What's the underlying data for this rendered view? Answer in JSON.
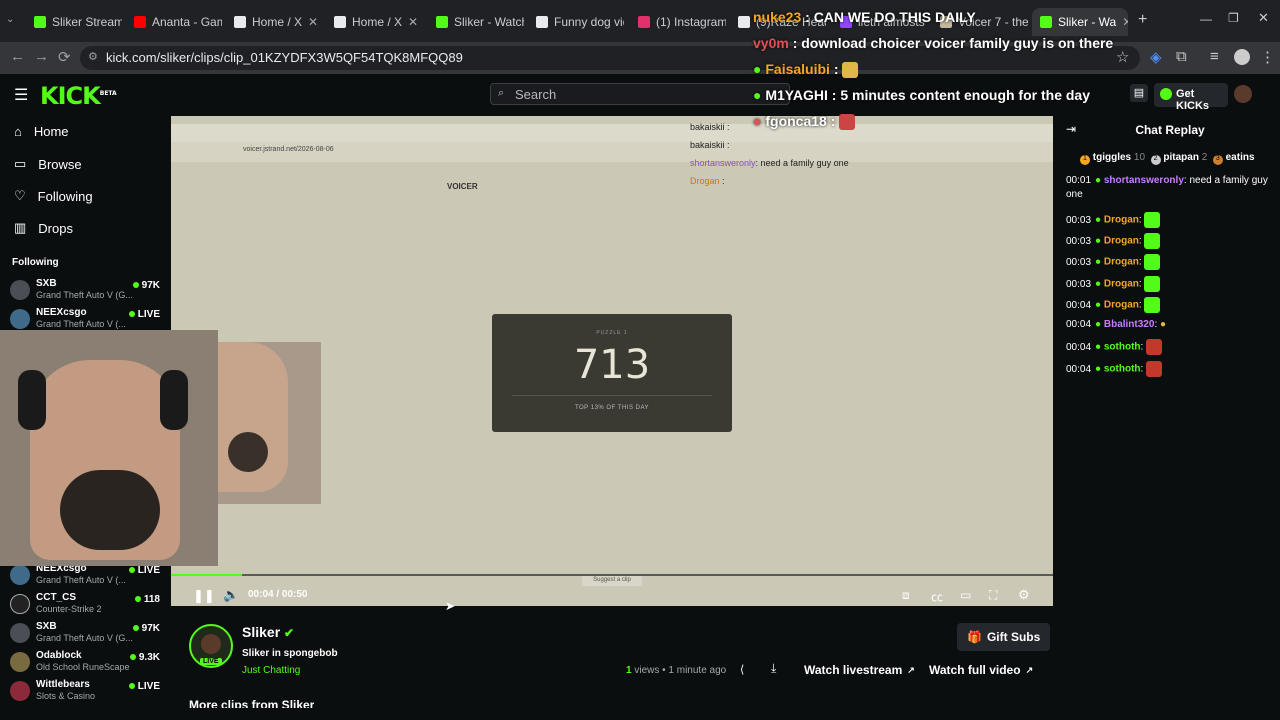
{
  "browser": {
    "tabs": [
      {
        "title": "Sliker Stream",
        "color": "#53fc18"
      },
      {
        "title": "Ananta - Game",
        "color": "#ff0000"
      },
      {
        "title": "Home / X",
        "color": "#e8eaed"
      },
      {
        "title": "Home / X",
        "color": "#e8eaed"
      },
      {
        "title": "Sliker - Watch",
        "color": "#53fc18"
      },
      {
        "title": "Funny dog vid",
        "color": "#e8eaed"
      },
      {
        "title": "(1) Instagram",
        "color": "#e1306c"
      },
      {
        "title": "(9)Raze Head",
        "color": "#e8eaed"
      },
      {
        "title": "lieth almosts g",
        "color": "#9146ff"
      },
      {
        "title": "Voicer 7 - the",
        "color": "#c5b79a"
      },
      {
        "title": "Sliker - Wa",
        "color": "#53fc18"
      }
    ],
    "url": "kick.com/sliker/clips/clip_01KZYDFX3W5QF54TQK8MFQQ89"
  },
  "topnav": {
    "logo": "KICK",
    "logo_beta": "BETA",
    "search_placeholder": "Search",
    "get_kicks": "Get KICKs"
  },
  "sidebar": {
    "menu": [
      "Home",
      "Browse",
      "Following",
      "Drops"
    ],
    "following_title": "Following",
    "following": [
      {
        "name": "SXB",
        "game": "Grand Theft Auto V (G...",
        "count": "97K"
      },
      {
        "name": "NEEXcsgo",
        "game": "Grand Theft Auto V (...",
        "count": "LIVE"
      }
    ],
    "following_lower": [
      {
        "name": "NEEXcsgo",
        "game": "Grand Theft Auto V (...",
        "count": "LIVE"
      },
      {
        "name": "CCT_CS",
        "game": "Counter-Strike 2",
        "count": "118"
      },
      {
        "name": "SXB",
        "game": "Grand Theft Auto V (G...",
        "count": "97K"
      },
      {
        "name": "Odablock",
        "game": "Old School RuneScape",
        "count": "9.3K"
      },
      {
        "name": "Wittlebears",
        "game": "Slots & Casino",
        "count": "LIVE"
      }
    ]
  },
  "stream_overlay": {
    "chat": [
      {
        "user": "nuke23",
        "text": ": CAN WE DO THIS DAILY",
        "color": "#f5a623"
      },
      {
        "user": "vy0m",
        "text": ": download choicer voicer family guy is on there",
        "color": "#e05050"
      },
      {
        "user": "Faisaluibi",
        "text": ":",
        "color": "#f5a623"
      },
      {
        "user": "M1YAGHI",
        "text": ": 5 minutes content enough for the day",
        "color": "#ffffff"
      },
      {
        "user": "fgonca18",
        "text": ":",
        "color": "#ffffff"
      }
    ],
    "small_chat": [
      {
        "user": "bakaiskii",
        "text": ":"
      },
      {
        "user": "bakaiskii",
        "text": ":"
      },
      {
        "user": "shortansweronly",
        "text": ": need a family guy one"
      },
      {
        "user": "Drogan",
        "text": ":"
      }
    ],
    "inner_url": "voicer.jstrand.net/2026-08-06",
    "inner_title": "VOICER",
    "puzzle_label": "PUZZLE 1",
    "puzzle_value": "713",
    "puzzle_sub": "TOP 13% OF THIS DAY"
  },
  "player": {
    "time": "00:04 / 00:50",
    "progress_fraction": 0.08,
    "suggest": "Suggest a clip"
  },
  "chat_replay": {
    "title": "Chat Replay",
    "top_gifters": [
      {
        "rank": "1",
        "name": "tgiggles",
        "count": "10"
      },
      {
        "rank": "2",
        "name": "pitapan",
        "count": "2"
      },
      {
        "rank": "3",
        "name": "eatins",
        "count": ""
      }
    ],
    "messages": [
      {
        "time": "00:01",
        "user": "shortansweronly",
        "text": ": need a family guy one",
        "color": "#c77dff"
      },
      {
        "time": "00:03",
        "user": "Drogan",
        "text": ":",
        "color": "#f5a623"
      },
      {
        "time": "00:03",
        "user": "Drogan",
        "text": ":",
        "color": "#f5a623"
      },
      {
        "time": "00:03",
        "user": "Drogan",
        "text": ":",
        "color": "#f5a623"
      },
      {
        "time": "00:03",
        "user": "Drogan",
        "text": ":",
        "color": "#f5a623"
      },
      {
        "time": "00:04",
        "user": "Drogan",
        "text": ":",
        "color": "#f5a623"
      },
      {
        "time": "00:04",
        "user": "Bbalint320",
        "text": ":",
        "color": "#c77dff"
      },
      {
        "time": "00:04",
        "user": "sothoth",
        "text": ":",
        "color": "#53fc18"
      },
      {
        "time": "00:04",
        "user": "sothoth",
        "text": ":",
        "color": "#53fc18"
      }
    ]
  },
  "channel": {
    "name": "Sliker",
    "clip_title": "Sliker in spongebob",
    "category": "Just Chatting",
    "live_badge": "LIVE",
    "views": "1",
    "views_label": "views",
    "ago": "• 1 minute ago",
    "gift_subs": "Gift Subs",
    "watch_livestream": "Watch livestream",
    "watch_full": "Watch full video",
    "more_clips": "More clips from Sliker"
  },
  "colors": {
    "accent": "#53fc18",
    "bg": "#0b0e0f"
  }
}
